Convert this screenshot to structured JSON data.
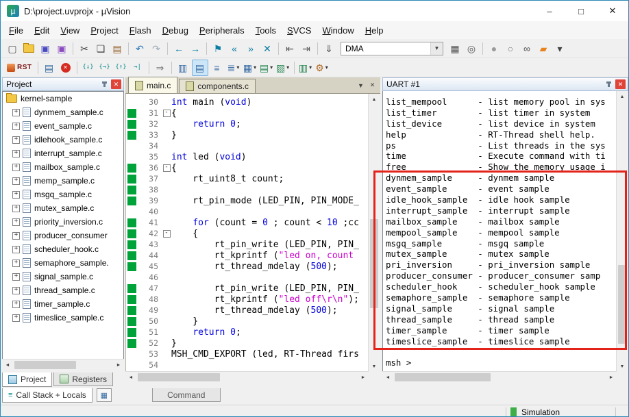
{
  "window": {
    "title": "D:\\project.uvprojx - µVision",
    "app_icon_text": "µ",
    "minimize": "–",
    "maximize": "□",
    "close": "✕"
  },
  "menu": {
    "items": [
      "File",
      "Edit",
      "View",
      "Project",
      "Flash",
      "Debug",
      "Peripherals",
      "Tools",
      "SVCS",
      "Window",
      "Help"
    ]
  },
  "toolbar_main": {
    "items": [
      {
        "name": "new-file-button",
        "glyph": "▢",
        "color": "#555555"
      },
      {
        "name": "open-file-button",
        "icon": "folder"
      },
      {
        "name": "save-button",
        "glyph": "▣",
        "color": "#4a4ac0"
      },
      {
        "name": "save-all-button",
        "glyph": "▣",
        "color": "#8a4ac0"
      },
      {
        "sep": true
      },
      {
        "name": "cut-button",
        "glyph": "✂",
        "color": "#444444"
      },
      {
        "name": "copy-button",
        "glyph": "❏",
        "color": "#444444"
      },
      {
        "name": "paste-button",
        "glyph": "▤",
        "color": "#996633"
      },
      {
        "sep": true
      },
      {
        "name": "undo-button",
        "glyph": "↶",
        "color": "#1f6fb5"
      },
      {
        "name": "redo-button",
        "glyph": "↷",
        "color": "#9aa7b5"
      },
      {
        "sep": true
      },
      {
        "name": "navigate-back-button",
        "glyph": "←",
        "color": "#0a7ea4"
      },
      {
        "name": "navigate-forward-button",
        "glyph": "→",
        "color": "#0a7ea4"
      },
      {
        "sep": true
      },
      {
        "name": "bookmark-toggle-button",
        "glyph": "⚑",
        "color": "#0a7ea4"
      },
      {
        "name": "bookmark-prev-button",
        "glyph": "«",
        "color": "#0a7ea4"
      },
      {
        "name": "bookmark-next-button",
        "glyph": "»",
        "color": "#0a7ea4"
      },
      {
        "name": "bookmark-clear-button",
        "glyph": "✕",
        "color": "#0a7ea4"
      },
      {
        "sep": true
      },
      {
        "name": "unindent-button",
        "glyph": "⇤",
        "color": "#555555"
      },
      {
        "name": "indent-button",
        "glyph": "⇥",
        "color": "#555555"
      },
      {
        "sep": true
      },
      {
        "name": "download-button",
        "glyph": "⇓",
        "color": "#555555"
      },
      {
        "combo": true,
        "name": "target-select",
        "value": "DMA"
      },
      {
        "name": "target-options-button",
        "glyph": "▦",
        "color": "#555555"
      },
      {
        "name": "find-in-files-button",
        "glyph": "◎",
        "color": "#555555"
      },
      {
        "sep": true
      },
      {
        "name": "breakpoint-disable-button",
        "glyph": "●",
        "color": "#9a9a9a"
      },
      {
        "name": "breakpoint-enable-button",
        "glyph": "○",
        "color": "#777777"
      },
      {
        "name": "spectacles-button",
        "glyph": "∞",
        "color": "#555555"
      },
      {
        "name": "flash-tools-button",
        "glyph": "▰",
        "color": "#e8821e"
      },
      {
        "name": "more-dropdown",
        "glyph": "▾",
        "color": "#444444"
      }
    ]
  },
  "toolbar_debug": {
    "items": [
      {
        "rst": true,
        "name": "reset-button",
        "label": "RST"
      },
      {
        "sep": true
      },
      {
        "name": "debug-session-button",
        "glyph": "▤",
        "color": "#3b6ea5"
      },
      {
        "name": "kill-all-button",
        "icon": "stop"
      },
      {
        "sep": true
      },
      {
        "name": "step-into-button",
        "glyph": "{↓}",
        "color": "#0a8a8a",
        "small": true
      },
      {
        "name": "step-over-button",
        "glyph": "{→}",
        "color": "#0a8a8a",
        "small": true
      },
      {
        "name": "step-out-button",
        "glyph": "{↑}",
        "color": "#0a8a8a",
        "small": true
      },
      {
        "name": "run-to-line-button",
        "glyph": "→|",
        "color": "#0a8a8a",
        "small": true
      },
      {
        "sep": true
      },
      {
        "name": "run-button",
        "glyph": "⇒",
        "color": "#777777"
      },
      {
        "sep": true
      },
      {
        "name": "command-window-button",
        "glyph": "▥",
        "color": "#3b6ea5"
      },
      {
        "name": "disassembly-window-button",
        "glyph": "▤",
        "color": "#3b6ea5",
        "pressed": true
      },
      {
        "name": "symbol-window-button",
        "glyph": "≡",
        "color": "#3b6ea5"
      },
      {
        "name": "watch-window-button",
        "glyph": "≣",
        "color": "#3b6ea5",
        "dropdown": true
      },
      {
        "name": "memory-window-button",
        "glyph": "▦",
        "color": "#3b6ea5",
        "dropdown": true
      },
      {
        "name": "serial-window-button",
        "glyph": "▤",
        "color": "#2e8b57",
        "dropdown": true
      },
      {
        "name": "analysis-window-button",
        "glyph": "▧",
        "color": "#2e8b57",
        "dropdown": true
      },
      {
        "sep": true
      },
      {
        "name": "system-viewer-button",
        "glyph": "▥",
        "color": "#2e8b57",
        "dropdown": true
      },
      {
        "name": "toolbox-button",
        "glyph": "⚙",
        "color": "#b06820",
        "dropdown": true
      }
    ]
  },
  "project_panel": {
    "title": "Project",
    "root": "kernel-sample",
    "files": [
      "dynmem_sample.c",
      "event_sample.c",
      "idlehook_sample.c",
      "interrupt_sample.c",
      "mailbox_sample.c",
      "memp_sample.c",
      "msgq_sample.c",
      "mutex_sample.c",
      "priority_inversion.c",
      "producer_consumer",
      "scheduler_hook.c",
      "semaphore_sample.",
      "signal_sample.c",
      "thread_sample.c",
      "timer_sample.c",
      "timeslice_sample.c"
    ]
  },
  "editor": {
    "tabs": [
      {
        "label": "main.c",
        "active": true
      },
      {
        "label": "components.c",
        "active": false
      }
    ],
    "lines": [
      {
        "n": 30,
        "g": 0,
        "f": 0,
        "s": [
          [
            "k",
            "int"
          ],
          [
            "p",
            " main ("
          ],
          [
            "k",
            "void"
          ],
          [
            "p",
            ")"
          ]
        ]
      },
      {
        "n": 31,
        "g": 1,
        "f": 1,
        "s": [
          [
            "p",
            "{"
          ]
        ]
      },
      {
        "n": 32,
        "g": 1,
        "f": 0,
        "s": [
          [
            "p",
            "    "
          ],
          [
            "k",
            "return"
          ],
          [
            "p",
            " "
          ],
          [
            "n",
            "0"
          ],
          [
            "p",
            ";"
          ]
        ]
      },
      {
        "n": 33,
        "g": 1,
        "f": 0,
        "s": [
          [
            "p",
            "}"
          ]
        ]
      },
      {
        "n": 34,
        "g": 0,
        "f": 0,
        "s": []
      },
      {
        "n": 35,
        "g": 0,
        "f": 0,
        "s": [
          [
            "k",
            "int"
          ],
          [
            "p",
            " led ("
          ],
          [
            "k",
            "void"
          ],
          [
            "p",
            ")"
          ]
        ]
      },
      {
        "n": 36,
        "g": 1,
        "f": 1,
        "s": [
          [
            "p",
            "{"
          ]
        ]
      },
      {
        "n": 37,
        "g": 1,
        "f": 0,
        "s": [
          [
            "p",
            "    rt_uint8_t count;"
          ]
        ]
      },
      {
        "n": 38,
        "g": 1,
        "f": 0,
        "s": []
      },
      {
        "n": 39,
        "g": 1,
        "f": 0,
        "s": [
          [
            "p",
            "    rt_pin_mode (LED_PIN, PIN_MODE_"
          ]
        ]
      },
      {
        "n": 40,
        "g": 0,
        "f": 0,
        "s": []
      },
      {
        "n": 41,
        "g": 1,
        "f": 0,
        "s": [
          [
            "p",
            "    "
          ],
          [
            "k",
            "for"
          ],
          [
            "p",
            " (count = "
          ],
          [
            "n",
            "0"
          ],
          [
            "p",
            " ; count < "
          ],
          [
            "n",
            "10"
          ],
          [
            "p",
            " ;cc"
          ]
        ]
      },
      {
        "n": 42,
        "g": 1,
        "f": 1,
        "s": [
          [
            "p",
            "    {"
          ]
        ]
      },
      {
        "n": 43,
        "g": 1,
        "f": 0,
        "s": [
          [
            "p",
            "        rt_pin_write (LED_PIN, PIN_"
          ]
        ]
      },
      {
        "n": 44,
        "g": 1,
        "f": 0,
        "s": [
          [
            "p",
            "        rt_kprintf ("
          ],
          [
            "s",
            "\"led on, count"
          ]
        ]
      },
      {
        "n": 45,
        "g": 1,
        "f": 0,
        "s": [
          [
            "p",
            "        rt_thread_mdelay ("
          ],
          [
            "n",
            "500"
          ],
          [
            "p",
            ");"
          ]
        ]
      },
      {
        "n": 46,
        "g": 0,
        "f": 0,
        "s": []
      },
      {
        "n": 47,
        "g": 1,
        "f": 0,
        "s": [
          [
            "p",
            "        rt_pin_write (LED_PIN, PIN_"
          ]
        ]
      },
      {
        "n": 48,
        "g": 1,
        "f": 0,
        "s": [
          [
            "p",
            "        rt_kprintf ("
          ],
          [
            "s",
            "\"led off\\r\\n\""
          ],
          [
            "p",
            ");"
          ]
        ]
      },
      {
        "n": 49,
        "g": 1,
        "f": 0,
        "s": [
          [
            "p",
            "        rt_thread_mdelay ("
          ],
          [
            "n",
            "500"
          ],
          [
            "p",
            ");"
          ]
        ]
      },
      {
        "n": 50,
        "g": 1,
        "f": 0,
        "s": [
          [
            "p",
            "    }"
          ]
        ]
      },
      {
        "n": 51,
        "g": 1,
        "f": 0,
        "s": [
          [
            "p",
            "    "
          ],
          [
            "k",
            "return"
          ],
          [
            "p",
            " "
          ],
          [
            "n",
            "0"
          ],
          [
            "p",
            ";"
          ]
        ]
      },
      {
        "n": 52,
        "g": 1,
        "f": 0,
        "s": [
          [
            "p",
            "}"
          ]
        ]
      },
      {
        "n": 53,
        "g": 0,
        "f": 0,
        "s": [
          [
            "p",
            "MSH_CMD_EXPORT (led, RT-Thread firs"
          ]
        ]
      },
      {
        "n": 54,
        "g": 0,
        "f": 0,
        "s": []
      }
    ]
  },
  "uart_panel": {
    "title": "UART #1",
    "lines": [
      "list_mempool      - list memory pool in sys",
      "list_timer        - list timer in system",
      "list_device       - list device in system",
      "help              - RT-Thread shell help.",
      "ps                - List threads in the sys",
      "time              - Execute command with ti",
      "free              - Show the memory usage i",
      "dynmem_sample     - dynmem sample",
      "event_sample      - event sample",
      "idle_hook_sample  - idle hook sample",
      "interrupt_sample  - interrupt sample",
      "mailbox_sample    - mailbox sample",
      "mempool_sample    - mempool sample",
      "msgq_sample       - msgq sample",
      "mutex_sample      - mutex sample",
      "pri_inversion     - pri_inversion sample",
      "producer_consumer - producer_consumer samp",
      "scheduler_hook    - scheduler_hook sample",
      "semaphore_sample  - semaphore sample",
      "signal_sample     - signal sample",
      "thread_sample     - thread sample",
      "timer_sample      - timer sample",
      "timeslice_sample  - timeslice sample",
      "",
      "msh >"
    ]
  },
  "bottom": {
    "project_tab": "Project",
    "registers_tab": "Registers",
    "call_stack_tab": "Call Stack + Locals",
    "command_tab": "Command"
  },
  "status": {
    "mode": "Simulation"
  }
}
